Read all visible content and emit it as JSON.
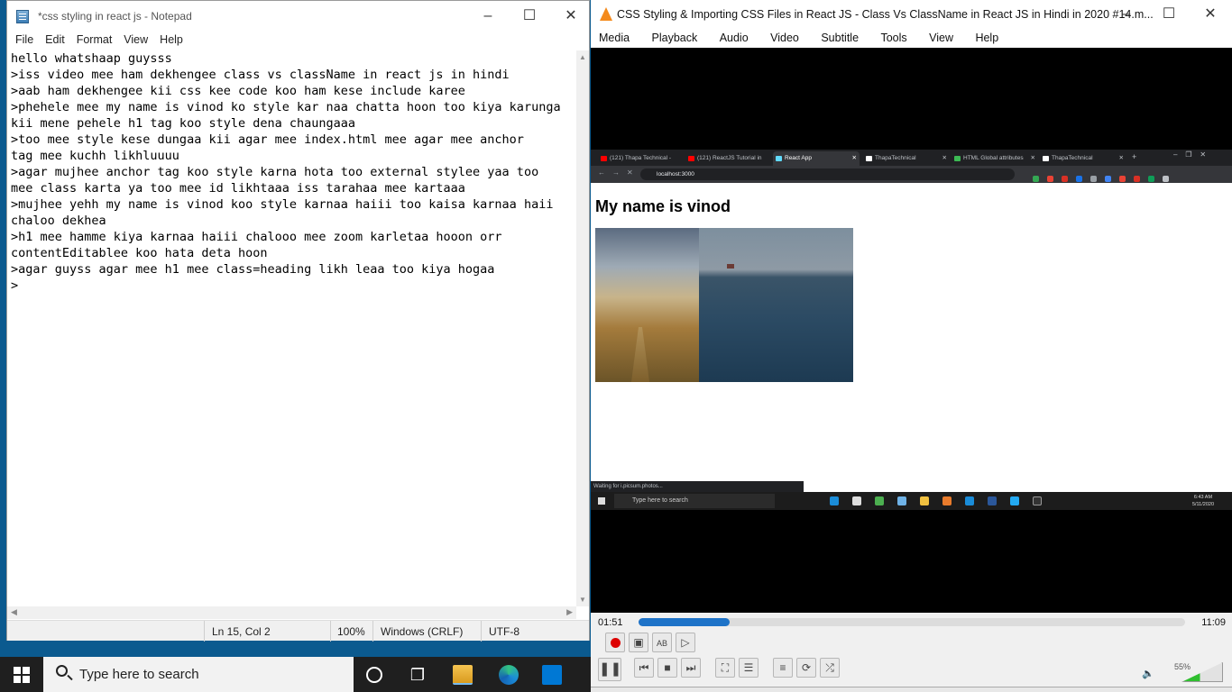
{
  "notepad": {
    "title": "*css styling in react js - Notepad",
    "menu": [
      "File",
      "Edit",
      "Format",
      "View",
      "Help"
    ],
    "lines": [
      "hello whatshaap guysss",
      ">iss video mee ham dekhengee class vs className in react js in hindi",
      ">aab ham dekhengee kii css kee code koo ham kese include karee",
      ">phehele mee my name is vinod ko style kar naa chatta hoon too kiya karunga",
      "kii mene pehele h1 tag koo style dena chaungaaa",
      ">too mee style kese dungaa kii agar mee index.html mee agar mee anchor",
      "tag mee kuchh likhluuuu",
      ">agar mujhee anchor tag koo style karna hota too external stylee yaa too",
      "mee class karta ya too mee id likhtaaa iss tarahaa mee kartaaa",
      ">mujhee yehh my name is vinod koo style karnaa haiii too kaisa karnaa haii",
      "chaloo dekhea",
      ">h1 mee hamme kiya karnaa haiii chalooo mee zoom karletaa hooon orr",
      "contentEditablee koo hata deta hoon",
      ">agar guyss agar mee h1 mee class=heading likh leaa too kiya hogaa",
      ">"
    ],
    "status": {
      "position": "Ln 15, Col 2",
      "zoom": "100%",
      "line_ending": "Windows (CRLF)",
      "encoding": "UTF-8"
    }
  },
  "vlc": {
    "title": "CSS Styling & Importing CSS Files in React JS - Class Vs ClassName in React JS in Hindi in 2020 #14.m...",
    "menu": [
      "Media",
      "Playback",
      "Audio",
      "Video",
      "Subtitle",
      "Tools",
      "View",
      "Help"
    ],
    "time_current": "01:51",
    "time_total": "11:09",
    "progress": 0.166,
    "volume": "55%",
    "video": {
      "tabs": [
        {
          "label": "(121) Thapa Technical - ",
          "color": "#ff0000"
        },
        {
          "label": "(121) ReactJS Tutorial in",
          "color": "#ff0000"
        },
        {
          "label": "React App",
          "color": "#61dafb"
        },
        {
          "label": "ThapaTechnical",
          "color": "#ffffff"
        },
        {
          "label": "HTML Global attributes",
          "color": "#3cba54"
        },
        {
          "label": "ThapaTechnical",
          "color": "#ffffff"
        }
      ],
      "url": "localhost:3000",
      "page_heading": "My name is vinod",
      "status_text": "Waiting for i.picsum.photos...",
      "taskbar_search": "Type here to search",
      "clock_time": "6:43 AM",
      "clock_date": "5/11/2020"
    }
  },
  "taskbar": {
    "search_placeholder": "Type here to search"
  },
  "colors": {
    "vlc_seek": "#1e73c8",
    "vlc_volume": "#2fbf2f",
    "taskbar_bg": "#1f1f1f"
  }
}
